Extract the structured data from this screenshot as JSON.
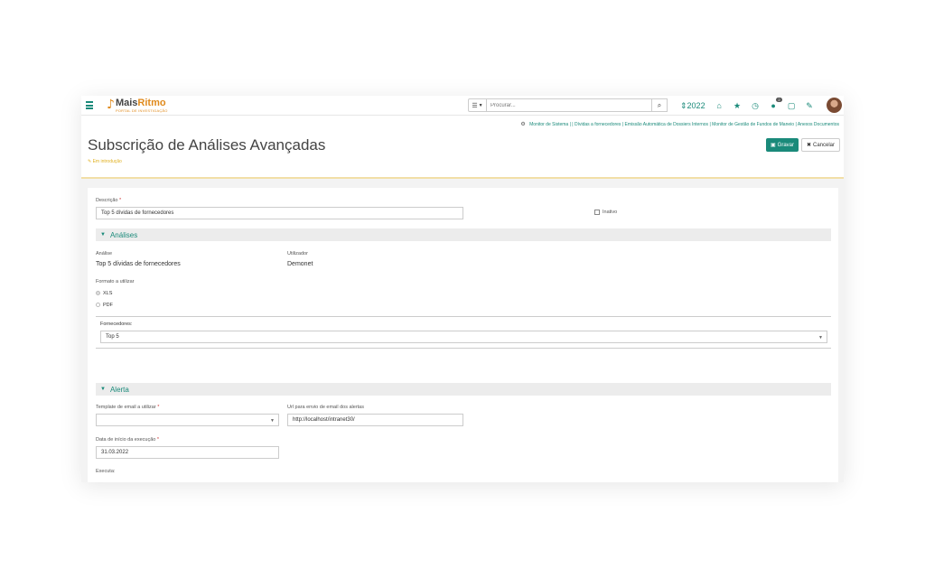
{
  "nav": {
    "logo_main_1": "Mais",
    "logo_main_2": "Ritmo",
    "logo_sub": "PORTAL DE INVESTIGAÇÃO",
    "search_mode_icon": "list-icon",
    "search_placeholder": "Procurar...",
    "year": "2022",
    "notification_count": "2",
    "icons": [
      "home-icon",
      "star-icon",
      "clock-icon",
      "chat-icon",
      "calendar-icon",
      "wrench-icon"
    ]
  },
  "breadcrumb": {
    "items": [
      "Monitor de Sistema",
      "Dívidas a fornecedores",
      "Emissão Automática de Dossiers Internos",
      "Monitor de Gestão de Fundos de Maneio",
      "Anexos Documentos"
    ]
  },
  "header": {
    "title": "Subscrição de Análises Avançadas",
    "status": "Em introdução",
    "save_label": "Gravar",
    "cancel_label": "Cancelar"
  },
  "form": {
    "descricao_label": "Descrição",
    "descricao_value": "Top 5 dívidas de fornecedores",
    "inativo_label": "Inativo",
    "analises_title": "Análises",
    "analise_label": "Análise",
    "analise_value": "Top 5 dívidas de fornecedores",
    "utilizador_label": "Utilizador",
    "utilizador_value": "Demonet",
    "formato_label": "Formato a utilizar",
    "formato_options": [
      "XLS",
      "PDF"
    ],
    "fornecedores_label": "Fornecedores:",
    "fornecedores_value": "Top 5",
    "alerta_title": "Alerta",
    "template_label": "Template de email a utilizar",
    "template_value": "",
    "url_label": "Url para envio de email dos alertas",
    "url_value": "http://localhost/intranet30/",
    "data_label": "Data de início da execução",
    "data_value": "31.03.2022",
    "executa_label": "Executa:",
    "required_mark": "*"
  },
  "colors": {
    "accent": "#1a8a7a",
    "brand_orange": "#e08a1c",
    "status_yellow": "#e0b020"
  }
}
